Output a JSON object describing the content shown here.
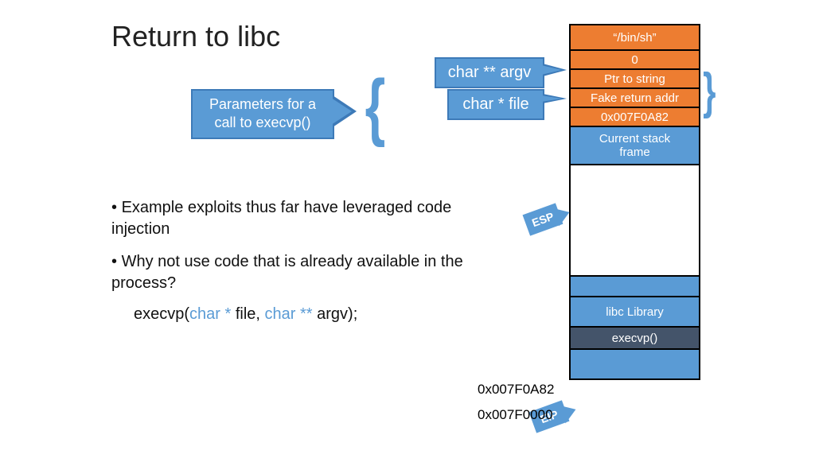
{
  "title": "Return to libc",
  "params_callout_line1": "Parameters for a",
  "params_callout_line2": "call to execvp()",
  "argv_label": "char ** argv",
  "file_label": "char * file",
  "stack": {
    "binsh": "“/bin/sh”",
    "zero": "0",
    "ptr": "Ptr to string",
    "fake_ret": "Fake return addr",
    "addr_hex": "0x007F0A82",
    "cur_frame_l1": "Current stack",
    "cur_frame_l2": "frame",
    "libc": "libc Library",
    "execvp": "execvp()"
  },
  "bullets": {
    "b1": "Example exploits thus far have leveraged code injection",
    "b2": "Why not use code that is already available in the process?"
  },
  "code": {
    "pre": "execvp(",
    "t1": "char * ",
    "mid1": "file, ",
    "t2": "char ** ",
    "post": "argv);"
  },
  "addr_top": "0x007F0A82",
  "addr_bot": "0x007F0000",
  "esp": "ESP",
  "eip": "EIP"
}
